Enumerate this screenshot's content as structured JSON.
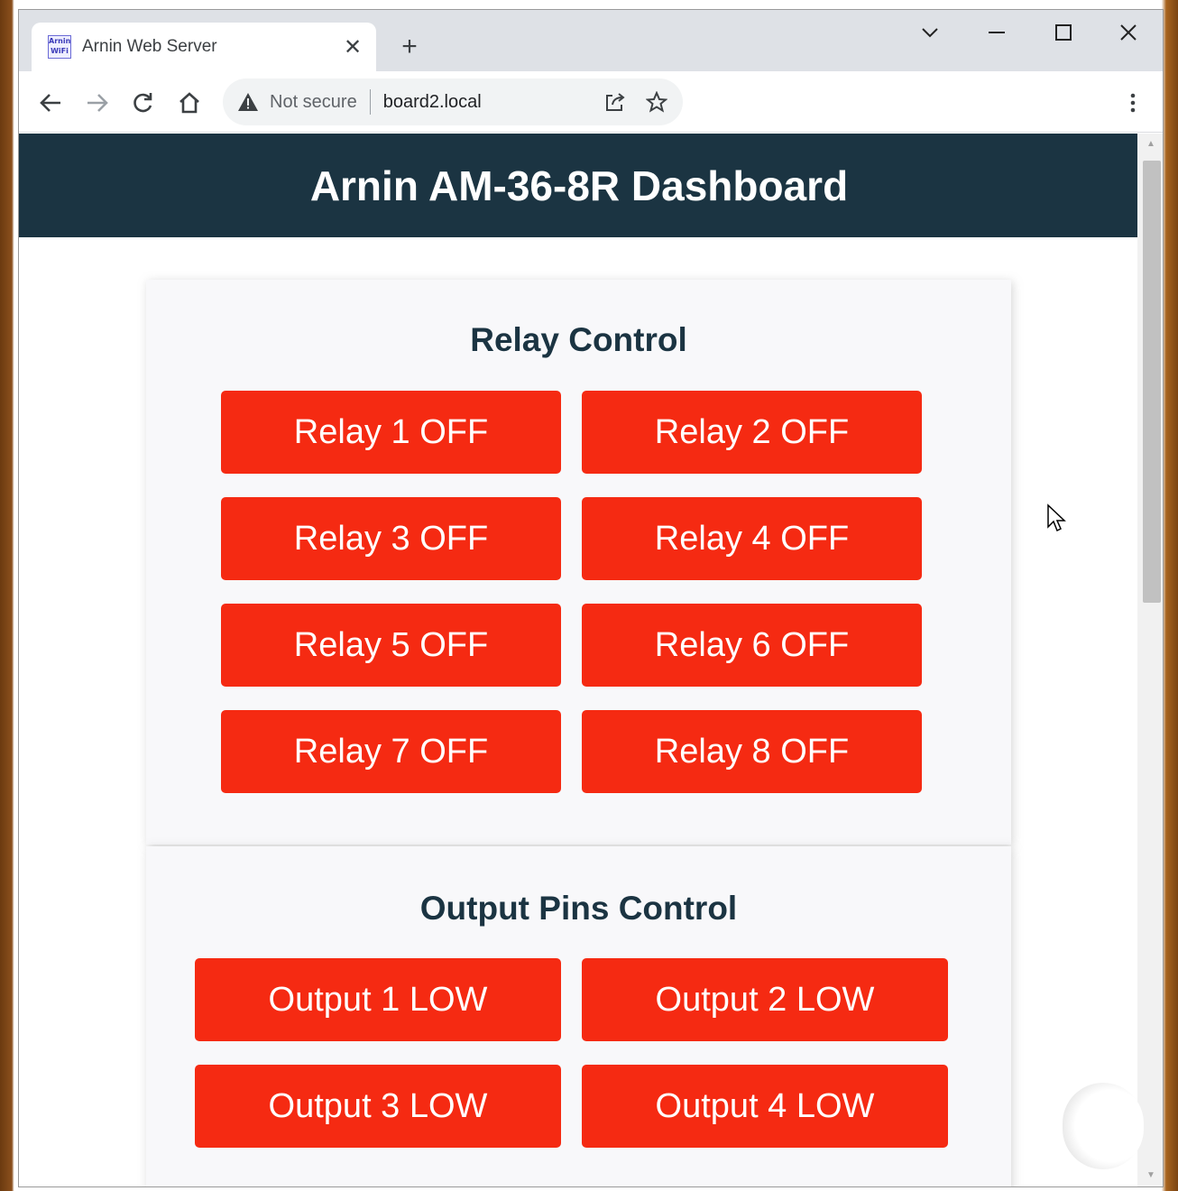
{
  "browser": {
    "tab_title": "Arnin Web Server",
    "favicon_text": "Arnin WiFi",
    "close_glyph": "✕",
    "newtab_glyph": "+",
    "security_label": "Not secure",
    "url": "board2.local",
    "window_controls": {
      "dropdown": "⌄",
      "minimize": "—",
      "maximize": "☐",
      "close": "✕"
    }
  },
  "page": {
    "title": "Arnin AM-36-8R Dashboard",
    "relay_section": {
      "heading": "Relay Control",
      "buttons": [
        "Relay 1 OFF",
        "Relay 2 OFF",
        "Relay 3 OFF",
        "Relay 4 OFF",
        "Relay 5 OFF",
        "Relay 6 OFF",
        "Relay 7 OFF",
        "Relay 8 OFF"
      ]
    },
    "output_section": {
      "heading": "Output Pins Control",
      "buttons": [
        "Output 1 LOW",
        "Output 2 LOW",
        "Output 3 LOW",
        "Output 4 LOW"
      ]
    }
  },
  "colors": {
    "header_bg": "#1b3442",
    "button_off": "#f52a12",
    "card_bg": "#f8f8fa"
  },
  "icons": [
    "back-icon",
    "forward-icon",
    "reload-icon",
    "home-icon",
    "warning-icon",
    "share-icon",
    "star-icon",
    "menu-icon"
  ]
}
